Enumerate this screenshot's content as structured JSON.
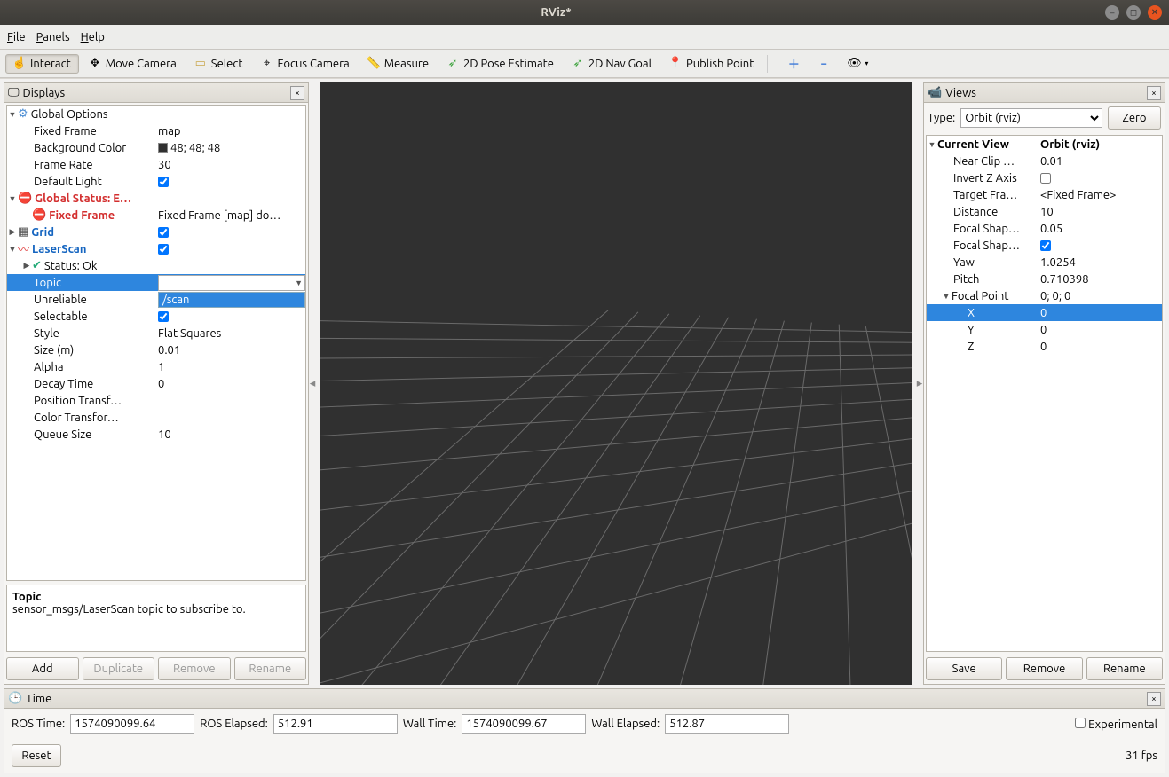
{
  "window": {
    "title": "RViz*"
  },
  "menus": {
    "file": "File",
    "panels": "Panels",
    "help": "Help"
  },
  "toolbar": {
    "interact": "Interact",
    "move_camera": "Move Camera",
    "select": "Select",
    "focus_camera": "Focus Camera",
    "measure": "Measure",
    "pose_estimate": "2D Pose Estimate",
    "nav_goal": "2D Nav Goal",
    "publish_point": "Publish Point"
  },
  "displays": {
    "title": "Displays",
    "global_options": "Global Options",
    "fixed_frame": {
      "label": "Fixed Frame",
      "value": "map"
    },
    "background": {
      "label": "Background Color",
      "value": "48; 48; 48"
    },
    "frame_rate": {
      "label": "Frame Rate",
      "value": "30"
    },
    "default_light": {
      "label": "Default Light"
    },
    "global_status": {
      "label": "Global Status: E…"
    },
    "fixed_frame_status": {
      "label": "Fixed Frame",
      "value": "Fixed Frame [map] do…"
    },
    "grid": "Grid",
    "laserscan": "LaserScan",
    "status_ok": "Status: Ok",
    "topic": {
      "label": "Topic",
      "dropdown": "/scan"
    },
    "unreliable": "Unreliable",
    "selectable": "Selectable",
    "style": {
      "label": "Style",
      "value": "Flat Squares"
    },
    "size": {
      "label": "Size (m)",
      "value": "0.01"
    },
    "alpha": {
      "label": "Alpha",
      "value": "1"
    },
    "decay": {
      "label": "Decay Time",
      "value": "0"
    },
    "pos_transform": "Position Transf…",
    "color_transform": "Color Transfor…",
    "queue": {
      "label": "Queue Size",
      "value": "10"
    },
    "help_title": "Topic",
    "help_text": "sensor_msgs/LaserScan topic to subscribe to.",
    "btn_add": "Add",
    "btn_dup": "Duplicate",
    "btn_rem": "Remove",
    "btn_ren": "Rename"
  },
  "views": {
    "title": "Views",
    "type_label": "Type:",
    "type_value": "Orbit (rviz)",
    "zero": "Zero",
    "current_view": {
      "label": "Current View",
      "value": "Orbit (rviz)"
    },
    "near_clip": {
      "label": "Near Clip …",
      "value": "0.01"
    },
    "invert_z": "Invert Z Axis",
    "target_frame": {
      "label": "Target Fra…",
      "value": "<Fixed Frame>"
    },
    "distance": {
      "label": "Distance",
      "value": "10"
    },
    "focal_shape_size": {
      "label": "Focal Shap…",
      "value": "0.05"
    },
    "focal_shape_fixed": {
      "label": "Focal Shap…"
    },
    "yaw": {
      "label": "Yaw",
      "value": "1.0254"
    },
    "pitch": {
      "label": "Pitch",
      "value": "0.710398"
    },
    "focal_point": {
      "label": "Focal Point",
      "value": "0; 0; 0"
    },
    "x": {
      "label": "X",
      "value": "0"
    },
    "y": {
      "label": "Y",
      "value": "0"
    },
    "z": {
      "label": "Z",
      "value": "0"
    },
    "btn_save": "Save",
    "btn_rem": "Remove",
    "btn_ren": "Rename"
  },
  "time": {
    "title": "Time",
    "ros_time_label": "ROS Time:",
    "ros_time": "1574090099.64",
    "ros_elapsed_label": "ROS Elapsed:",
    "ros_elapsed": "512.91",
    "wall_time_label": "Wall Time:",
    "wall_time": "1574090099.67",
    "wall_elapsed_label": "Wall Elapsed:",
    "wall_elapsed": "512.87",
    "experimental": "Experimental",
    "reset": "Reset",
    "fps": "31 fps"
  }
}
